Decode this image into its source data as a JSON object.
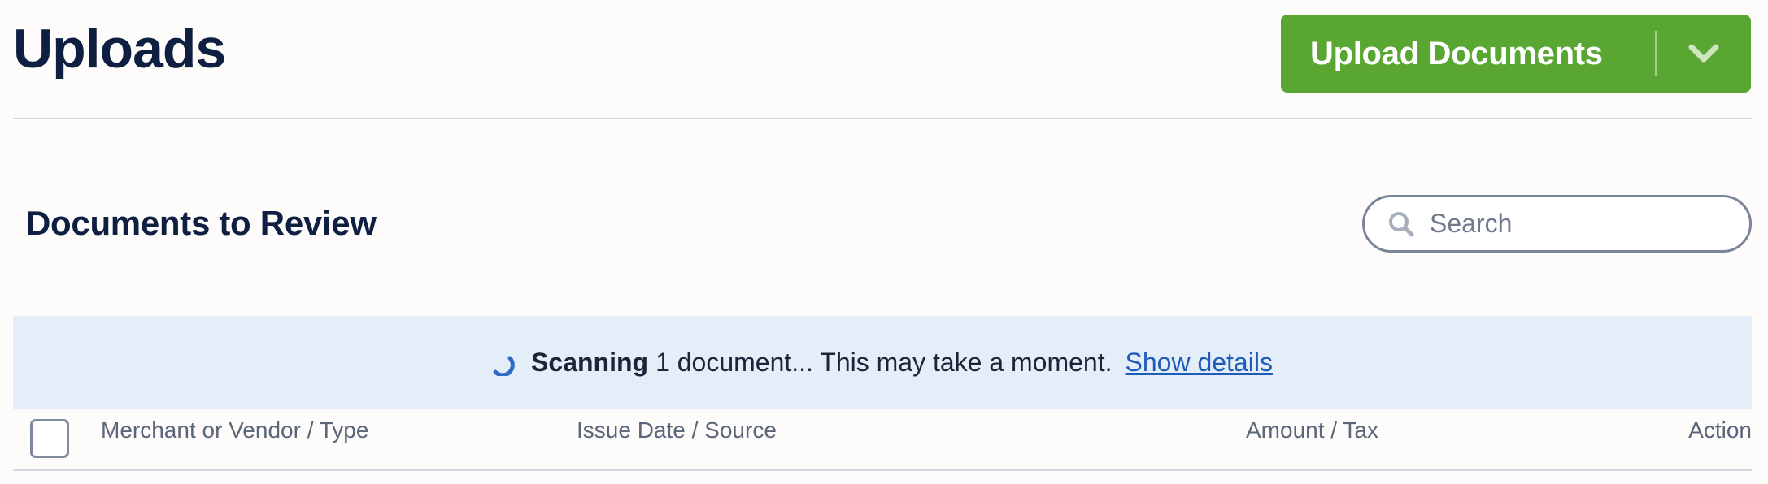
{
  "header": {
    "title": "Uploads",
    "upload_button_label": "Upload Documents",
    "upload_button_caret_icon": "chevron-down-icon"
  },
  "section": {
    "title": "Documents to Review"
  },
  "search": {
    "placeholder": "Search",
    "value": "",
    "icon": "search-icon"
  },
  "scan_banner": {
    "icon": "spinner-icon",
    "strong_text": "Scanning",
    "message": "1 document... This may take a moment.",
    "link_label": "Show details"
  },
  "table": {
    "columns": [
      "Merchant or Vendor / Type",
      "Issue Date / Source",
      "Amount / Tax",
      "Action"
    ],
    "select_all_checked": false
  },
  "colors": {
    "brand_green": "#59a633",
    "heading_navy": "#0e1f42",
    "banner_blue": "#e4eef9",
    "link_blue": "#1f5bb8"
  }
}
